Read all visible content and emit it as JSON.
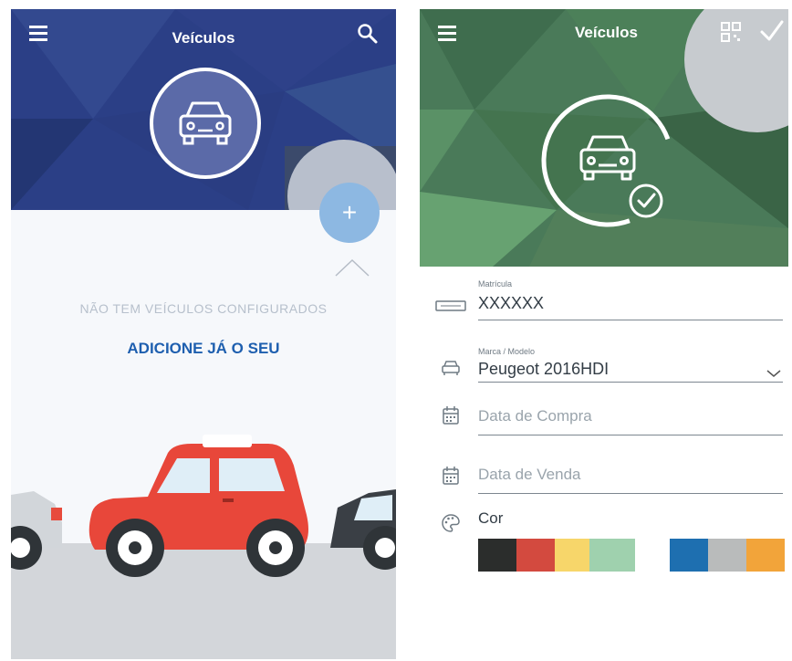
{
  "left_screen": {
    "title": "Veículos",
    "empty_message": "NÃO TEM VEÍCULOS CONFIGURADOS",
    "add_cta": "ADICIONE JÁ O SEU",
    "fab_symbol": "+",
    "header_color": "#2b3f86"
  },
  "right_screen": {
    "title": "Veículos",
    "header_color": "#4a7a59",
    "fields": {
      "plate": {
        "label": "Matrícula",
        "value": "XXXXXX"
      },
      "model": {
        "label": "Marca / Modelo",
        "value": "Peugeot  2016HDI"
      },
      "purchase_date": {
        "placeholder": "Data de Compra"
      },
      "sale_date": {
        "placeholder": "Data de Venda"
      },
      "color": {
        "label": "Cor"
      }
    },
    "swatches": [
      "#2b2d2c",
      "#d34a3f",
      "#f7d66a",
      "#9fd1ae",
      "#ffffff",
      "#1e6fb0",
      "#b9bbbb",
      "#f2a43a"
    ]
  }
}
